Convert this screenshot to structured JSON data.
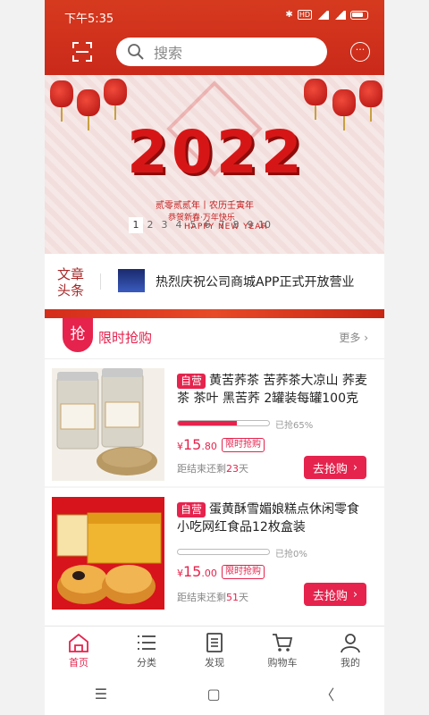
{
  "status_bar": {
    "time": "下午5:35",
    "icons": [
      "bluetooth-icon",
      "hd-icon",
      "4g-signal-icon",
      "wifi-signal-icon",
      "battery-icon"
    ]
  },
  "header": {
    "search_placeholder": "搜索",
    "scan_icon": "scan-icon",
    "more_icon": "more-icon"
  },
  "banner": {
    "year": "2022",
    "line1": "贰零贰贰年丨农历壬寅年",
    "line2": "恭贺新春·万年快乐",
    "line3": "HAPPY NEW YEAR",
    "pages": [
      "1",
      "2",
      "3",
      "4",
      "5",
      "6",
      "7",
      "8",
      "9",
      "10"
    ],
    "active_page": "1"
  },
  "news": {
    "tag": "文章头条",
    "headline": "热烈庆祝公司商城APP正式开放营业"
  },
  "flash_sale": {
    "badge": "抢",
    "title": "限时抢购",
    "more": "更多"
  },
  "products": [
    {
      "tag": "自营",
      "name": "黄苦荞茶 苦荞茶大凉山 荞麦茶 茶叶 黑苦荞 2罐装每罐100克",
      "progress": 0.65,
      "progress_label": "已抢65%",
      "currency": "¥",
      "price_int": "15",
      "price_dec": ".80",
      "price_tag": "限时抢购",
      "countdown_prefix": "距结束还剩",
      "countdown_days": "23",
      "countdown_unit": "天",
      "buy_label": "去抢购"
    },
    {
      "tag": "自营",
      "name": "蛋黄酥雪媚娘糕点休闲零食小吃网红食品12枚盒装",
      "progress": 0.0,
      "progress_label": "已抢0%",
      "currency": "¥",
      "price_int": "15",
      "price_dec": ".00",
      "price_tag": "限时抢购",
      "countdown_prefix": "距结束还剩",
      "countdown_days": "51",
      "countdown_unit": "天",
      "buy_label": "去抢购"
    }
  ],
  "tabbar": [
    {
      "label": "首页",
      "icon": "home-icon",
      "active": true
    },
    {
      "label": "分类",
      "icon": "category-icon",
      "active": false
    },
    {
      "label": "发现",
      "icon": "discover-icon",
      "active": false
    },
    {
      "label": "购物车",
      "icon": "cart-icon",
      "active": false
    },
    {
      "label": "我的",
      "icon": "profile-icon",
      "active": false
    }
  ],
  "system_nav": {
    "menu": "☰",
    "home": "▢",
    "back": "〈"
  },
  "colors": {
    "brand_red": "#e5234d",
    "header_red": "#d63a1e",
    "banner_red": "#d61616"
  }
}
